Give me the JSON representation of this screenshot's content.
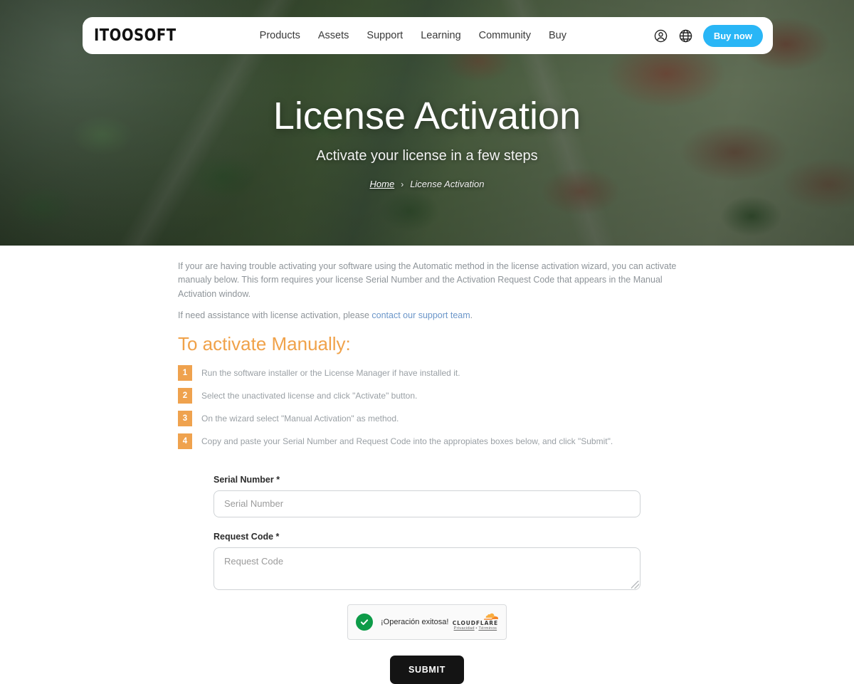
{
  "header": {
    "logo": "ITOOSOFT",
    "nav": [
      {
        "label": "Products"
      },
      {
        "label": "Assets"
      },
      {
        "label": "Support"
      },
      {
        "label": "Learning"
      },
      {
        "label": "Community"
      },
      {
        "label": "Buy"
      }
    ],
    "account_icon": "account-circle-icon",
    "language_icon": "globe-icon",
    "buy_now_label": "Buy now",
    "buy_now_color": "#29b6f6"
  },
  "hero": {
    "title": "License Activation",
    "subtitle": "Activate your license in a few steps",
    "breadcrumb": {
      "home": "Home",
      "separator": "›",
      "current": "License Activation"
    }
  },
  "main": {
    "paragraph_1": "If your are having trouble activating your software using the Automatic method in the license activation wizard, you can activate manualy below. This form requires your license Serial Number and the Activation Request Code that appears in the Manual Activation window.",
    "paragraph_2_before": "If need assistance with license activation, please ",
    "paragraph_2_link": "contact our support team",
    "paragraph_2_after": ".",
    "section_title": "To activate Manually:",
    "section_title_color": "#f0a24a",
    "steps": [
      {
        "num": "1",
        "text": "Run the software installer or the License Manager if have installed it."
      },
      {
        "num": "2",
        "text": "Select the unactivated license and click \"Activate\" button."
      },
      {
        "num": "3",
        "text": "On the wizard select \"Manual Activation\" as method."
      },
      {
        "num": "4",
        "text": "Copy and paste your Serial Number and Request Code into the appropiates boxes below, and click \"Submit\"."
      }
    ]
  },
  "form": {
    "serial": {
      "label": "Serial Number *",
      "placeholder": "Serial Number",
      "value": ""
    },
    "request": {
      "label": "Request Code *",
      "placeholder": "Request Code",
      "value": ""
    },
    "turnstile": {
      "status": "¡Operación exitosa!",
      "check_icon": "checkmark-icon",
      "brand_icon": "cloudflare-cloud-icon",
      "brand": "CLOUDFLARE",
      "privacy": "Privacidad",
      "dot": " • ",
      "terms": "Términos",
      "brand_color": "#f48120"
    },
    "submit_label": "SUBMIT"
  }
}
